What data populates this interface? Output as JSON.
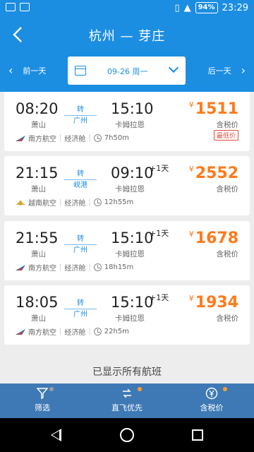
{
  "status_bar": {
    "battery": "94%",
    "time": "23:29"
  },
  "header": {
    "title": "杭州 — 芽庄"
  },
  "date_bar": {
    "prev_label": "前一天",
    "date": "09-26 周一",
    "next_label": "后一天"
  },
  "flights": [
    {
      "dep_time": "08:20",
      "dep_airport": "萧山",
      "transfer_label": "转",
      "transfer_city": "广州",
      "arr_time": "15:10",
      "plus_day": "",
      "arr_airport": "卡姆拉恩",
      "airline": "南方航空",
      "cabin": "经济舱",
      "duration": "7h50m",
      "currency": "¥",
      "price": "1511",
      "tax_note": "含税价",
      "badge": "最低价"
    },
    {
      "dep_time": "21:15",
      "dep_airport": "萧山",
      "transfer_label": "转",
      "transfer_city": "岘港",
      "arr_time": "09:10",
      "plus_day": "+1天",
      "arr_airport": "卡姆拉恩",
      "airline": "越南航空",
      "cabin": "经济舱",
      "duration": "12h55m",
      "currency": "¥",
      "price": "2552",
      "tax_note": "含税价",
      "badge": ""
    },
    {
      "dep_time": "21:55",
      "dep_airport": "萧山",
      "transfer_label": "转",
      "transfer_city": "广州",
      "arr_time": "15:10",
      "plus_day": "+1天",
      "arr_airport": "卡姆拉恩",
      "airline": "南方航空",
      "cabin": "经济舱",
      "duration": "18h15m",
      "currency": "¥",
      "price": "1678",
      "tax_note": "含税价",
      "badge": ""
    },
    {
      "dep_time": "18:05",
      "dep_airport": "萧山",
      "transfer_label": "转",
      "transfer_city": "广州",
      "arr_time": "15:10",
      "plus_day": "+1天",
      "arr_airport": "卡姆拉恩",
      "airline": "南方航空",
      "cabin": "经济舱",
      "duration": "22h5m",
      "currency": "¥",
      "price": "1934",
      "tax_note": "含税价",
      "badge": ""
    }
  ],
  "footer_note": "已显示所有航班",
  "filter_bar": {
    "filter": {
      "label": "筛选",
      "dot_color": "#9e9e9e"
    },
    "direct": {
      "label": "直飞优先",
      "dot_color": "#ff9a2e"
    },
    "tax_price": {
      "label": "含税价",
      "dot_color": "#ff9a2e"
    }
  },
  "colors": {
    "brand": "#1c8ee2",
    "price": "#ff7a1a",
    "filter_bar": "#3e79b5"
  },
  "icons": {
    "china_southern": "china-southern-logo-icon",
    "vietnam_airlines": "vietnam-airlines-logo-icon"
  }
}
